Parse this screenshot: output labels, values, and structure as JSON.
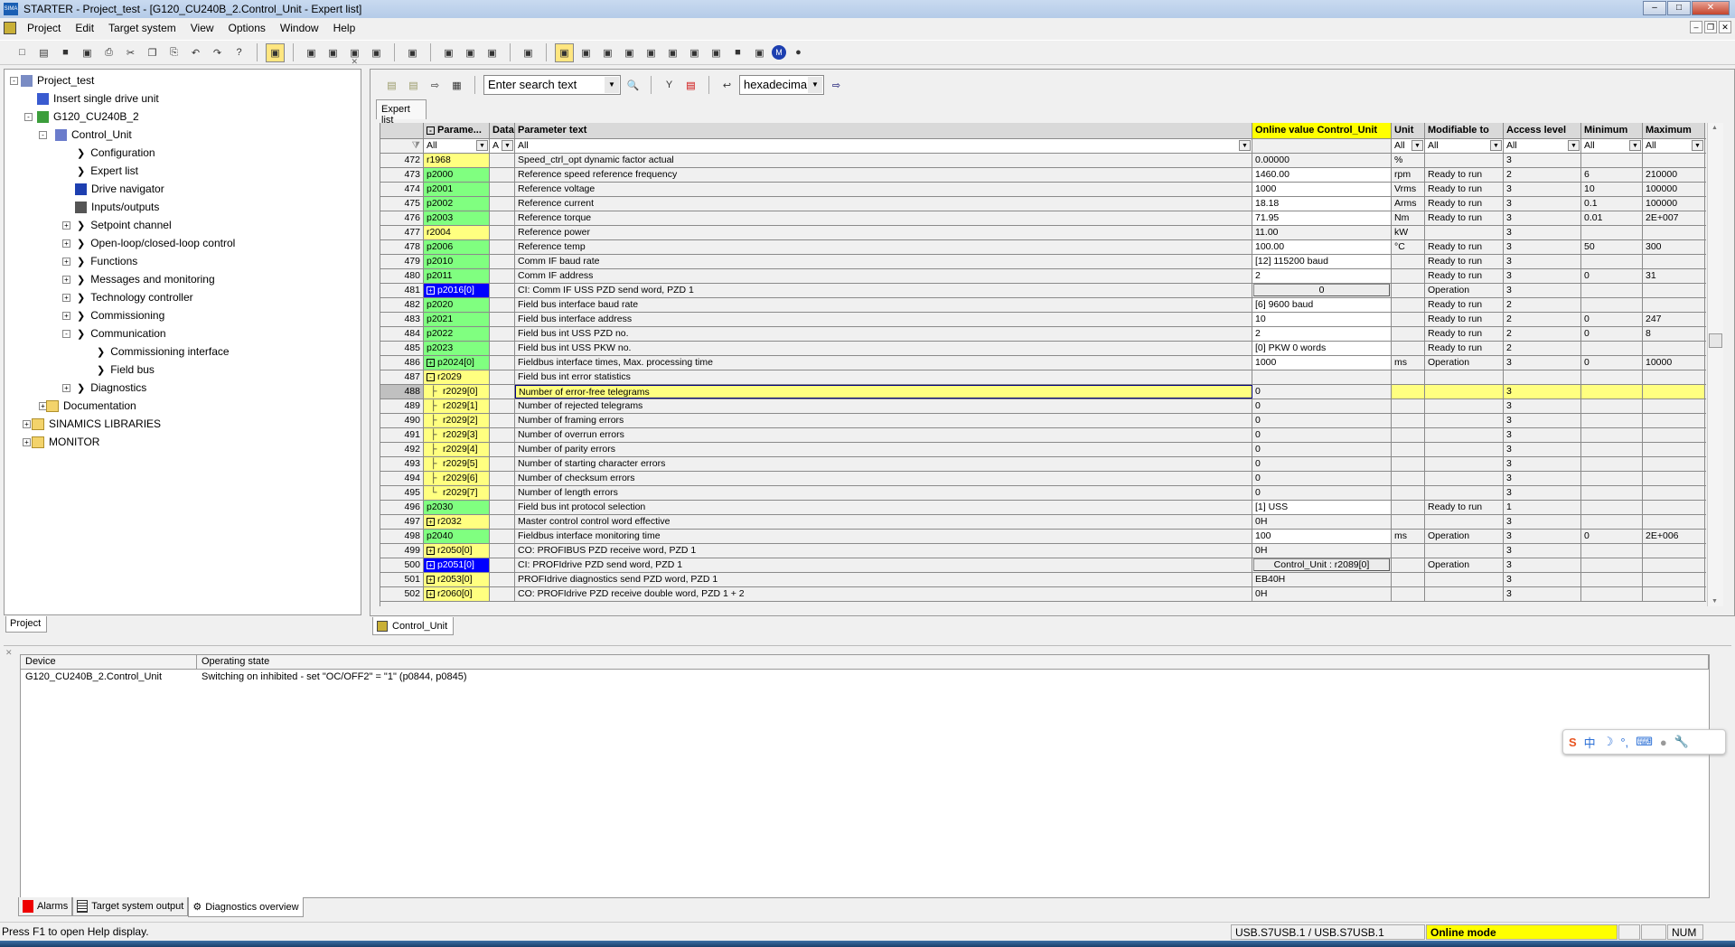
{
  "window": {
    "title": "STARTER - Project_test - [G120_CU240B_2.Control_Unit - Expert list]",
    "app_icon_text": "SIMA"
  },
  "menu": [
    "Project",
    "Edit",
    "Target system",
    "View",
    "Options",
    "Window",
    "Help"
  ],
  "toolbar_icons": [
    "new-icon",
    "open-icon",
    "save-icon",
    "save-compile-icon",
    "print-icon",
    "cut-icon",
    "copy-icon",
    "paste-icon",
    "undo-icon",
    "redo-icon",
    "help-icon",
    "sep",
    "accessible-nodes-icon",
    "sep",
    "connect-icon",
    "download-icon",
    "upload-icon",
    "copy-ram-rom-icon",
    "sep",
    "device-config-icon",
    "sep",
    "trace-icon",
    "function-generator-icon",
    "measure-icon",
    "sep",
    "project-icon",
    "sep",
    "expert-list-icon",
    "drive-navigator-icon",
    "control-panel-icon",
    "alarms-icon",
    "curve-icon",
    "ramp-icon",
    "scope-icon",
    "record-icon",
    "stop-icon",
    "diag-icon",
    "m-icon",
    "circle-icon"
  ],
  "tree": {
    "items": [
      {
        "label": "Project_test",
        "level": 0,
        "exp": "-",
        "icon": "project"
      },
      {
        "label": "Insert single drive unit",
        "level": 1,
        "icon": "insert"
      },
      {
        "label": "G120_CU240B_2",
        "level": 1,
        "exp": "-",
        "icon": "drive"
      },
      {
        "label": "Control_Unit",
        "level": 2,
        "exp": "-",
        "icon": "cu"
      },
      {
        "label": "Configuration",
        "level": 3,
        "chev": true
      },
      {
        "label": "Expert list",
        "level": 3,
        "chev": true
      },
      {
        "label": "Drive navigator",
        "level": 3,
        "icon": "nav"
      },
      {
        "label": "Inputs/outputs",
        "level": 3,
        "icon": "io"
      },
      {
        "label": "Setpoint channel",
        "level": 3,
        "exp": "+",
        "chev2": true
      },
      {
        "label": "Open-loop/closed-loop control",
        "level": 3,
        "exp": "+",
        "chev2": true
      },
      {
        "label": "Functions",
        "level": 3,
        "exp": "+",
        "chev2": true
      },
      {
        "label": "Messages and monitoring",
        "level": 3,
        "exp": "+",
        "chev2": true
      },
      {
        "label": "Technology controller",
        "level": 3,
        "exp": "+",
        "chev2": true
      },
      {
        "label": "Commissioning",
        "level": 3,
        "exp": "+",
        "chev2": true
      },
      {
        "label": "Communication",
        "level": 3,
        "exp": "-",
        "chev2": true
      },
      {
        "label": "Commissioning interface",
        "level": 4,
        "chev": true
      },
      {
        "label": "Field bus",
        "level": 4,
        "chev": true
      },
      {
        "label": "Diagnostics",
        "level": 3,
        "exp": "+",
        "chev2": true
      },
      {
        "label": "Documentation",
        "level": 2,
        "exp": "+",
        "icon": "folder"
      },
      {
        "label": "SINAMICS LIBRARIES",
        "level": 1,
        "exp": "+",
        "icon": "folder",
        "top": true
      },
      {
        "label": "MONITOR",
        "level": 1,
        "exp": "+",
        "icon": "folder",
        "top": true
      }
    ],
    "tab": "Project"
  },
  "expert": {
    "search_placeholder": "Enter search text",
    "number_format": "hexadecima",
    "tab": "Expert list",
    "bottom_tab": "Control_Unit",
    "headers": [
      "",
      "Parame...",
      "Data",
      "Parameter text",
      "Online value Control_Unit",
      "Unit",
      "Modifiable to",
      "Access level",
      "Minimum",
      "Maximum"
    ],
    "filters": [
      "",
      "All",
      "A",
      "All",
      "",
      "All",
      "All",
      "All",
      "All",
      "All"
    ],
    "rows": [
      {
        "n": "472",
        "p": "r1968",
        "k": "y",
        "pre": "",
        "t": "Speed_ctrl_opt dynamic factor actual",
        "v": "0.00000",
        "vs": "ro",
        "u": "%",
        "m": "",
        "a": "3",
        "min": "",
        "max": ""
      },
      {
        "n": "473",
        "p": "p2000",
        "k": "g",
        "pre": "",
        "t": "Reference speed reference frequency",
        "v": "1460.00",
        "vs": "edit",
        "u": "rpm",
        "m": "Ready to run",
        "a": "2",
        "min": "6",
        "max": "210000"
      },
      {
        "n": "474",
        "p": "p2001",
        "k": "g",
        "pre": "",
        "t": "Reference voltage",
        "v": "1000",
        "vs": "edit",
        "u": "Vrms",
        "m": "Ready to run",
        "a": "3",
        "min": "10",
        "max": "100000"
      },
      {
        "n": "475",
        "p": "p2002",
        "k": "g",
        "pre": "",
        "t": "Reference current",
        "v": "18.18",
        "vs": "edit",
        "u": "Arms",
        "m": "Ready to run",
        "a": "3",
        "min": "0.1",
        "max": "100000"
      },
      {
        "n": "476",
        "p": "p2003",
        "k": "g",
        "pre": "",
        "t": "Reference torque",
        "v": "71.95",
        "vs": "edit",
        "u": "Nm",
        "m": "Ready to run",
        "a": "3",
        "min": "0.01",
        "max": "2E+007"
      },
      {
        "n": "477",
        "p": "r2004",
        "k": "y",
        "pre": "",
        "t": "Reference power",
        "v": "11.00",
        "vs": "ro",
        "u": "kW",
        "m": "",
        "a": "3",
        "min": "",
        "max": ""
      },
      {
        "n": "478",
        "p": "p2006",
        "k": "g",
        "pre": "",
        "t": "Reference temp",
        "v": "100.00",
        "vs": "edit",
        "u": "°C",
        "m": "Ready to run",
        "a": "3",
        "min": "50",
        "max": "300"
      },
      {
        "n": "479",
        "p": "p2010",
        "k": "g",
        "pre": "",
        "t": "Comm IF baud rate",
        "v": "[12] 115200 baud",
        "vs": "edit",
        "u": "",
        "m": "Ready to run",
        "a": "3",
        "min": "",
        "max": ""
      },
      {
        "n": "480",
        "p": "p2011",
        "k": "g",
        "pre": "",
        "t": "Comm IF address",
        "v": "2",
        "vs": "edit",
        "u": "",
        "m": "Ready to run",
        "a": "3",
        "min": "0",
        "max": "31"
      },
      {
        "n": "481",
        "p": "p2016[0]",
        "k": "b",
        "pre": "+",
        "t": "CI: Comm IF USS PZD send word, PZD 1",
        "v": "0",
        "vs": "btn",
        "u": "",
        "m": "Operation",
        "a": "3",
        "min": "",
        "max": ""
      },
      {
        "n": "482",
        "p": "p2020",
        "k": "g",
        "pre": "",
        "t": "Field bus interface baud rate",
        "v": "[6] 9600 baud",
        "vs": "edit",
        "u": "",
        "m": "Ready to run",
        "a": "2",
        "min": "",
        "max": ""
      },
      {
        "n": "483",
        "p": "p2021",
        "k": "g",
        "pre": "",
        "t": "Field bus interface address",
        "v": "10",
        "vs": "edit",
        "u": "",
        "m": "Ready to run",
        "a": "2",
        "min": "0",
        "max": "247"
      },
      {
        "n": "484",
        "p": "p2022",
        "k": "g",
        "pre": "",
        "t": "Field bus int USS PZD no.",
        "v": "2",
        "vs": "edit",
        "u": "",
        "m": "Ready to run",
        "a": "2",
        "min": "0",
        "max": "8"
      },
      {
        "n": "485",
        "p": "p2023",
        "k": "g",
        "pre": "",
        "t": "Field bus int USS PKW no.",
        "v": "[0]  PKW 0 words",
        "vs": "edit",
        "u": "",
        "m": "Ready to run",
        "a": "2",
        "min": "",
        "max": ""
      },
      {
        "n": "486",
        "p": "p2024[0]",
        "k": "g",
        "pre": "+",
        "t": "Fieldbus interface times, Max. processing time",
        "v": "1000",
        "vs": "edit",
        "u": "ms",
        "m": "Operation",
        "a": "3",
        "min": "0",
        "max": "10000"
      },
      {
        "n": "487",
        "p": "r2029",
        "k": "y",
        "pre": "-",
        "t": "Field bus int error statistics",
        "v": "",
        "vs": "ro",
        "u": "",
        "m": "",
        "a": "",
        "min": "",
        "max": ""
      },
      {
        "n": "488",
        "p": "r2029[0]",
        "k": "y",
        "pre": "├",
        "t": "Number of error-free telegrams",
        "v": "0",
        "vs": "ro",
        "u": "",
        "m": "",
        "a": "3",
        "min": "",
        "max": "",
        "sel": true
      },
      {
        "n": "489",
        "p": "r2029[1]",
        "k": "y",
        "pre": "├",
        "t": "Number of rejected telegrams",
        "v": "0",
        "vs": "ro",
        "u": "",
        "m": "",
        "a": "3",
        "min": "",
        "max": ""
      },
      {
        "n": "490",
        "p": "r2029[2]",
        "k": "y",
        "pre": "├",
        "t": "Number of framing errors",
        "v": "0",
        "vs": "ro",
        "u": "",
        "m": "",
        "a": "3",
        "min": "",
        "max": ""
      },
      {
        "n": "491",
        "p": "r2029[3]",
        "k": "y",
        "pre": "├",
        "t": "Number of overrun errors",
        "v": "0",
        "vs": "ro",
        "u": "",
        "m": "",
        "a": "3",
        "min": "",
        "max": ""
      },
      {
        "n": "492",
        "p": "r2029[4]",
        "k": "y",
        "pre": "├",
        "t": "Number of parity errors",
        "v": "0",
        "vs": "ro",
        "u": "",
        "m": "",
        "a": "3",
        "min": "",
        "max": ""
      },
      {
        "n": "493",
        "p": "r2029[5]",
        "k": "y",
        "pre": "├",
        "t": "Number of starting character errors",
        "v": "0",
        "vs": "ro",
        "u": "",
        "m": "",
        "a": "3",
        "min": "",
        "max": ""
      },
      {
        "n": "494",
        "p": "r2029[6]",
        "k": "y",
        "pre": "├",
        "t": "Number of checksum errors",
        "v": "0",
        "vs": "ro",
        "u": "",
        "m": "",
        "a": "3",
        "min": "",
        "max": ""
      },
      {
        "n": "495",
        "p": "r2029[7]",
        "k": "y",
        "pre": "└",
        "t": "Number of length errors",
        "v": "0",
        "vs": "ro",
        "u": "",
        "m": "",
        "a": "3",
        "min": "",
        "max": ""
      },
      {
        "n": "496",
        "p": "p2030",
        "k": "g",
        "pre": "",
        "t": "Field bus int protocol selection",
        "v": "[1] USS",
        "vs": "edit",
        "u": "",
        "m": "Ready to run",
        "a": "1",
        "min": "",
        "max": ""
      },
      {
        "n": "497",
        "p": "r2032",
        "k": "y",
        "pre": "+",
        "t": "Master control control word effective",
        "v": "0H",
        "vs": "ro",
        "u": "",
        "m": "",
        "a": "3",
        "min": "",
        "max": ""
      },
      {
        "n": "498",
        "p": "p2040",
        "k": "g",
        "pre": "",
        "t": "Fieldbus interface monitoring time",
        "v": "100",
        "vs": "edit",
        "u": "ms",
        "m": "Operation",
        "a": "3",
        "min": "0",
        "max": "2E+006"
      },
      {
        "n": "499",
        "p": "r2050[0]",
        "k": "y",
        "pre": "+",
        "t": "CO: PROFIBUS PZD receive word, PZD 1",
        "v": "0H",
        "vs": "ro",
        "u": "",
        "m": "",
        "a": "3",
        "min": "",
        "max": ""
      },
      {
        "n": "500",
        "p": "p2051[0]",
        "k": "b",
        "pre": "+",
        "t": "CI: PROFIdrive PZD send word, PZD 1",
        "v": "Control_Unit : r2089[0]",
        "vs": "btn",
        "u": "",
        "m": "Operation",
        "a": "3",
        "min": "",
        "max": ""
      },
      {
        "n": "501",
        "p": "r2053[0]",
        "k": "y",
        "pre": "+",
        "t": "PROFIdrive diagnostics send PZD word, PZD 1",
        "v": "EB40H",
        "vs": "ro",
        "u": "",
        "m": "",
        "a": "3",
        "min": "",
        "max": ""
      },
      {
        "n": "502",
        "p": "r2060[0]",
        "k": "y",
        "pre": "+",
        "t": "CO: PROFIdrive PZD receive double word, PZD 1 + 2",
        "v": "0H",
        "vs": "ro",
        "u": "",
        "m": "",
        "a": "3",
        "min": "",
        "max": ""
      }
    ]
  },
  "diagnostics": {
    "headers": [
      "Device",
      "Operating state"
    ],
    "rows": [
      {
        "device": "G120_CU240B_2.Control_Unit",
        "state": "Switching on inhibited - set \"OC/OFF2\" = \"1\" (p0844, p0845)"
      }
    ],
    "tabs": [
      "Alarms",
      "Target system output",
      "Diagnostics overview"
    ],
    "active_tab": "Diagnostics overview"
  },
  "status": {
    "help": "Press F1 to open Help display.",
    "interface": "USB.S7USB.1 / USB.S7USB.1",
    "mode": "Online mode",
    "num": "NUM"
  },
  "colors": {
    "param_writable": "#80ff80",
    "param_readonly": "#ffff80",
    "param_connector": "#0000ff",
    "online_header": "#ffff00",
    "online_mode": "#ffff00"
  }
}
